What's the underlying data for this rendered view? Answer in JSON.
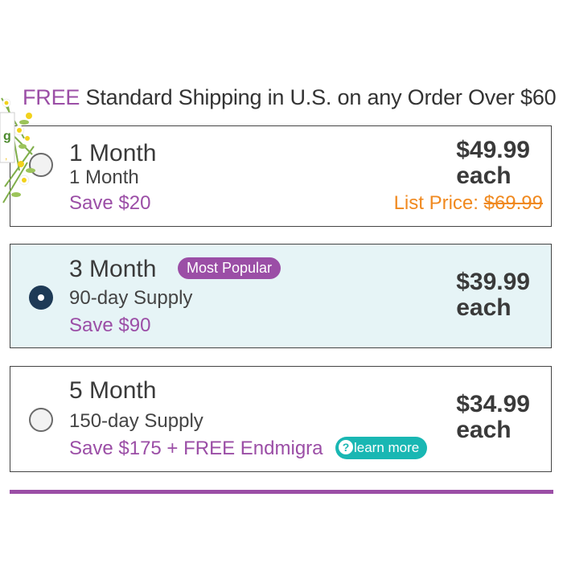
{
  "shipping": {
    "free": "FREE",
    "text": " Standard Shipping in U.S. on any Order Over $60"
  },
  "options": [
    {
      "title": "1 Month",
      "subtitle": "1 Month",
      "save": "Save $20",
      "price": "$49.99",
      "unit": "each",
      "list_price_label": "List Price: ",
      "list_price": "$69.99",
      "selected": false
    },
    {
      "title": "3 Month",
      "badge": "Most Popular",
      "subtitle": "90-day Supply",
      "save": "Save $90",
      "price": "$39.99",
      "unit": "each",
      "selected": true
    },
    {
      "title": "5 Month",
      "subtitle": "150-day Supply",
      "save": "Save $175 + FREE Endmigra",
      "price": "$34.99",
      "unit": "each",
      "learn_more": "learn more",
      "learn_more_icon": "?",
      "selected": false
    }
  ],
  "colors": {
    "accent": "#9b4ea6",
    "list_price": "#f0891f",
    "selected_bg": "#e6f4f6",
    "radio_checked": "#1e3a56",
    "learn_more_bg": "#19b7b3"
  },
  "icons": [
    "flower-decoration-icon",
    "radio-icon",
    "question-circle-icon"
  ]
}
